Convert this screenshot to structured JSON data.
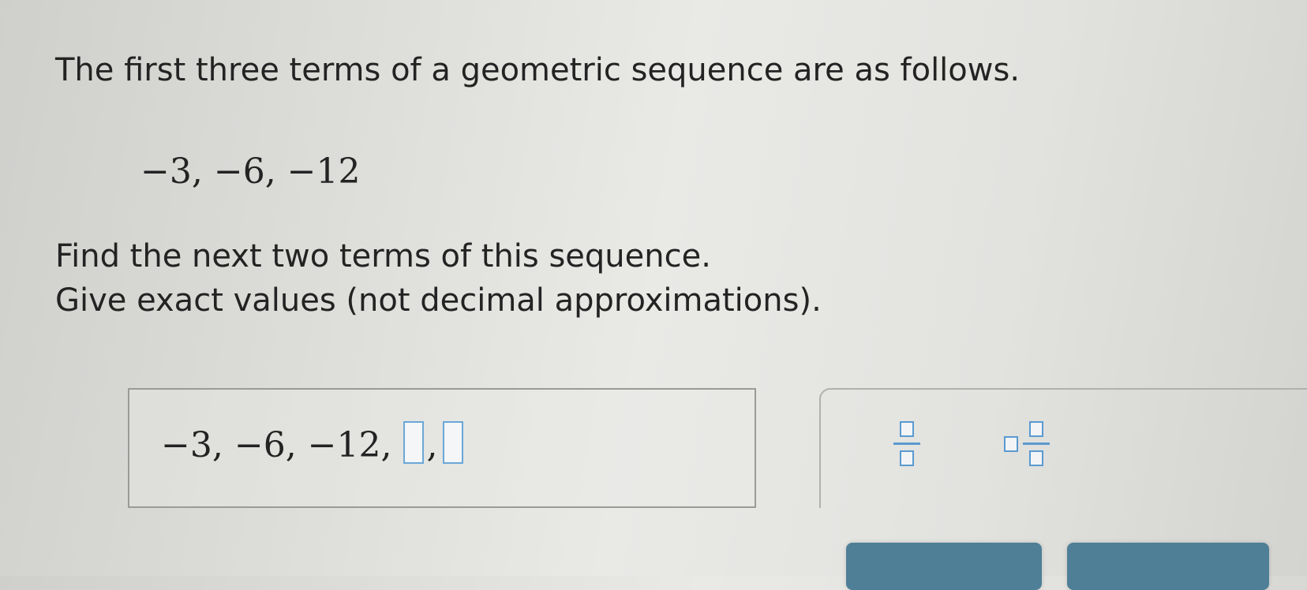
{
  "question": {
    "line1": "The first three terms of a geometric sequence are as follows.",
    "given_terms": "−3,  −6,  −12",
    "line3": "Find the next two terms of this sequence.",
    "line4": "Give exact values (not decimal approximations)."
  },
  "answer": {
    "prefix": "−3, −6, −12,",
    "separator": ",",
    "term4_value": "",
    "term5_value": ""
  },
  "toolbar": {
    "tools": [
      "fraction-icon",
      "mixed-number-icon"
    ]
  },
  "colors": {
    "input_border": "#6aa8d8",
    "button_fill": "#4f7f96"
  }
}
